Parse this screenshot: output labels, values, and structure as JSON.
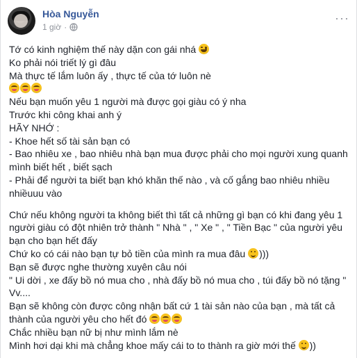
{
  "post": {
    "author": "Hòa Nguyễn",
    "time": "1 giờ",
    "dot": "·",
    "more": "···",
    "icons": {
      "privacy": "globe-icon",
      "menu": "more-options-icon"
    }
  },
  "lines": [
    "Tớ có kinh nghiệm thế này dặn con gái nhá",
    "Ko phải nói triết lý gì đâu",
    "Mà thực tế lắm luôn ấy , thực tế của tớ luôn nè",
    "",
    "Nếu bạn muốn yêu 1 người mà được gọi giàu có ý nha",
    "Trước khi công khai anh ý",
    "HÃY NHỚ :",
    "- Khoe hết số tài sản bạn có",
    "- Bao nhiêu xe , bao nhiêu nhà bạn mua được phải cho mọi người xung quanh",
    "mình biết hết , biết sạch",
    "- Phải để người ta biết bạn khó khăn thế nào , và cố gắng bao nhiêu nhiều",
    "nhiềuuu vào",
    "Chứ nếu không người ta không biết thì tất cả những gì bạn có khi đang yêu 1",
    "người giàu có đột nhiên trở thành \" Nhà \" , \" Xe \" , \" Tiền Bạc \" của người yêu",
    "bạn cho bạn hết đấy",
    "Chứ ko có cái nào bạn tự bỏ tiền của mình ra mua đâu",
    ")))",
    "Bạn sẽ được nghe thường xuyên câu nói",
    "\" Ui dời , xe đấy bồ nó mua cho , nhà đấy bồ nó mua cho , túi đấy bồ nó tặng \"",
    "Vv....",
    "Bạn sẽ không còn được công nhận bất cứ 1 tài sản nào của bạn , mà tất cả",
    "thành của người yêu cho hết đó",
    "Chắc nhiều bạn nữ bị như mình lắm nè",
    "Mình hơi dại khi mà chẳng khoe mấy cái to to thành ra giờ mới thế",
    "))"
  ],
  "colors": {
    "name": "#365899",
    "text": "#1d2129",
    "meta": "#90949c",
    "emoji": "#f7c21d"
  }
}
